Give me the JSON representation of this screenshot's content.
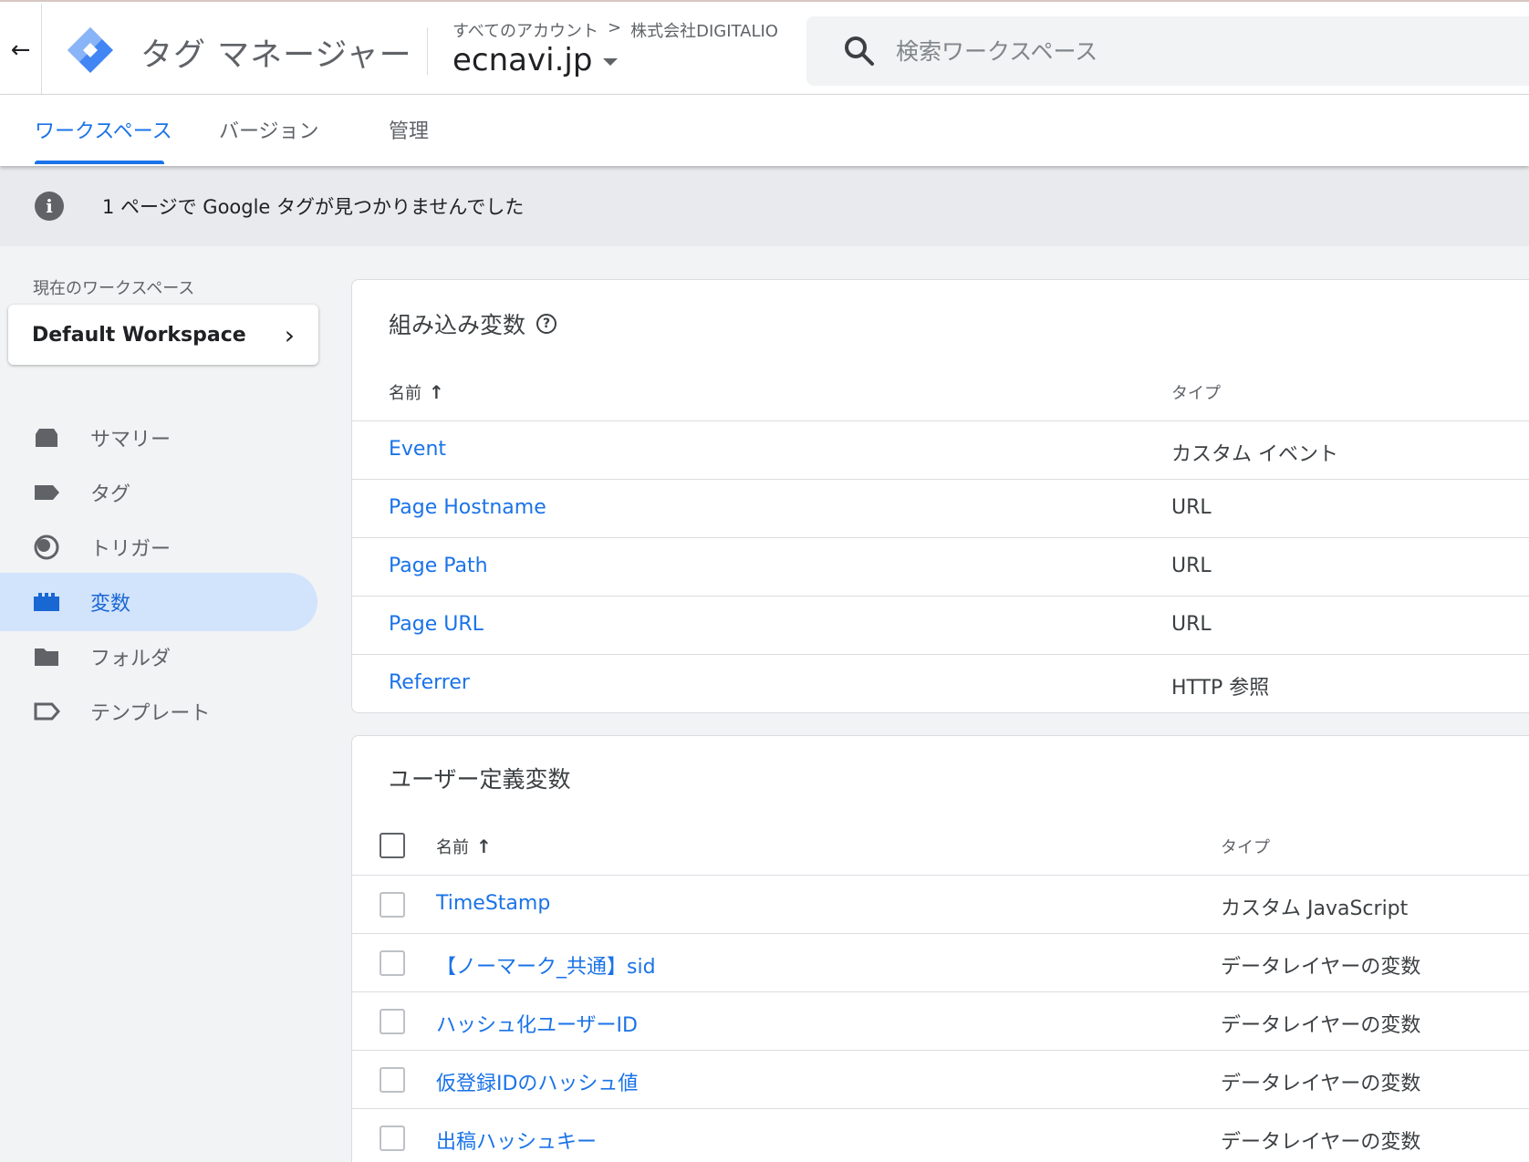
{
  "header": {
    "product_name": "タグ マネージャー",
    "breadcrumb_all_accounts": "すべてのアカウント",
    "breadcrumb_separator": ">",
    "breadcrumb_account": "株式会社DIGITALIO",
    "container_name": "ecnavi.jp",
    "search_placeholder": "検索ワークスペース"
  },
  "tabs": [
    {
      "label": "ワークスペース",
      "active": true
    },
    {
      "label": "バージョン",
      "active": false
    },
    {
      "label": "管理",
      "active": false
    }
  ],
  "banner": {
    "icon": "i",
    "message": "1 ページで Google タグが見つかりませんでした"
  },
  "sidebar": {
    "workspace_label": "現在のワークスペース",
    "workspace_name": "Default Workspace",
    "workspace_chevron": "›",
    "items": [
      {
        "label": "サマリー",
        "icon": "summary-icon",
        "active": false
      },
      {
        "label": "タグ",
        "icon": "tag-icon",
        "active": false
      },
      {
        "label": "トリガー",
        "icon": "trigger-icon",
        "active": false
      },
      {
        "label": "変数",
        "icon": "variable-icon",
        "active": true
      },
      {
        "label": "フォルダ",
        "icon": "folder-icon",
        "active": false
      },
      {
        "label": "テンプレート",
        "icon": "template-icon",
        "active": false
      }
    ]
  },
  "builtin": {
    "title": "組み込み変数",
    "help": "?",
    "col_name": "名前",
    "sort_arrow": "↑",
    "col_type": "タイプ",
    "rows": [
      {
        "name": "Event",
        "type": "カスタム イベント"
      },
      {
        "name": "Page Hostname",
        "type": "URL"
      },
      {
        "name": "Page Path",
        "type": "URL"
      },
      {
        "name": "Page URL",
        "type": "URL"
      },
      {
        "name": "Referrer",
        "type": "HTTP 参照"
      }
    ]
  },
  "user_defined": {
    "title": "ユーザー定義変数",
    "col_name": "名前",
    "sort_arrow": "↑",
    "col_type": "タイプ",
    "rows": [
      {
        "name": "TimeStamp",
        "type": "カスタム JavaScript"
      },
      {
        "name": "【ノーマーク_共通】sid",
        "type": "データレイヤーの変数"
      },
      {
        "name": "ハッシュ化ユーザーID",
        "type": "データレイヤーの変数"
      },
      {
        "name": "仮登録IDのハッシュ値",
        "type": "データレイヤーの変数"
      },
      {
        "name": "出稿ハッシュキー",
        "type": "データレイヤーの変数"
      }
    ]
  },
  "colors": {
    "accent": "#1a73e8",
    "active_nav_bg": "#d2e3fc",
    "banner_bg": "#e8eaed"
  }
}
